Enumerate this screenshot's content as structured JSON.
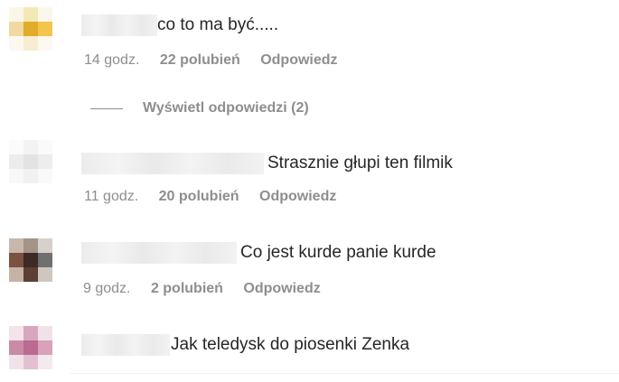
{
  "comments": [
    {
      "text": "co to ma być.....",
      "time": "14 godz.",
      "likes": "22 polubień",
      "reply": "Odpowiedz",
      "avatar_colors": [
        "#fbf7e8",
        "#f3e9b5",
        "#fbf7ec",
        "#f1d9a1",
        "#e0ad2a",
        "#f3c64b",
        "#fbf8f0",
        "#f8edd2",
        "#fcf9f1"
      ]
    },
    {
      "text": "Strasznie głupi ten filmik",
      "time": "11 godz.",
      "likes": "20 polubień",
      "reply": "Odpowiedz",
      "avatar_colors": [
        "#fbfbfb",
        "#f3f3f3",
        "#fafafa",
        "#ececec",
        "#e3e3e3",
        "#ededed",
        "#f8f8f8",
        "#f1f1f1",
        "#f9f9f9"
      ]
    },
    {
      "text": "Co jest kurde panie kurde",
      "time": "9 godz.",
      "likes": "2 polubień",
      "reply": "Odpowiedz",
      "avatar_colors": [
        "#c9b7ac",
        "#a49487",
        "#d8d0ca",
        "#7b5140",
        "#3d2a24",
        "#6f6f70",
        "#c7b2a6",
        "#5c3f35",
        "#cfc6c0"
      ]
    },
    {
      "text": "Jak teledysk do piosenki Zenka",
      "avatar_colors": [
        "#f3e3ea",
        "#d8a7be",
        "#f1e1e8",
        "#c98aa8",
        "#b96b92",
        "#d9a1ba",
        "#f0e4ea",
        "#e3c0d0",
        "#f4e9ee"
      ]
    }
  ],
  "view_replies": "Wyświetl odpowiedzi (2)"
}
